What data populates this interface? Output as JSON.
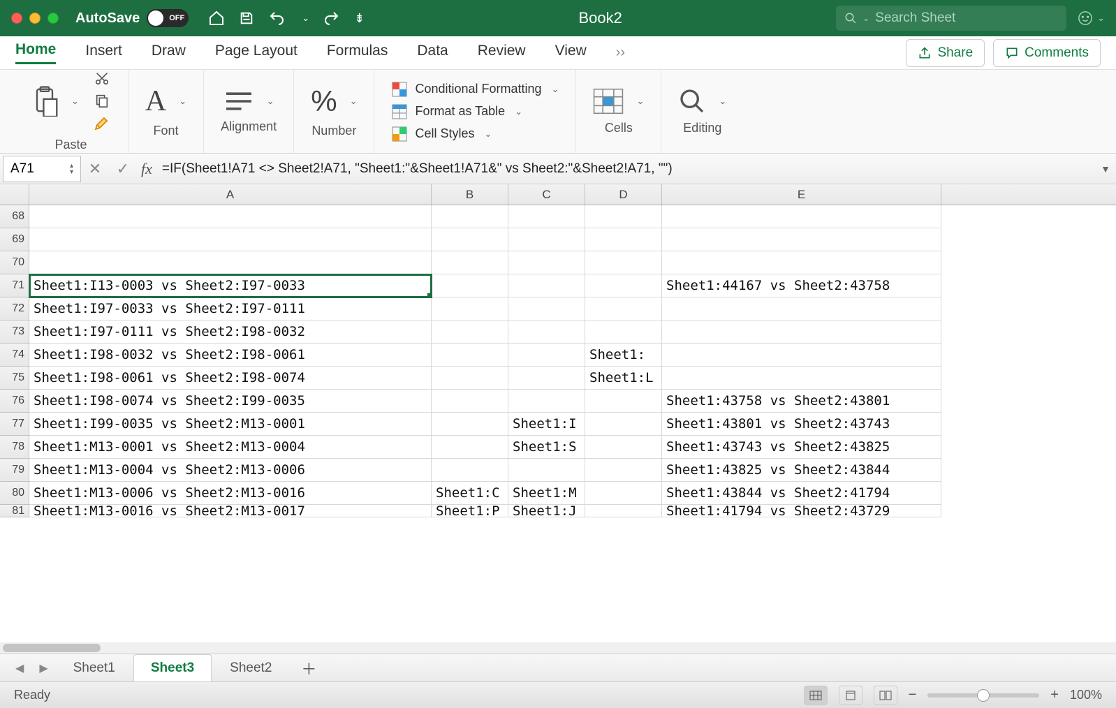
{
  "titlebar": {
    "autosave_label": "AutoSave",
    "autosave_state": "OFF",
    "doc_title": "Book2",
    "search_placeholder": "Search Sheet"
  },
  "tabs": {
    "home": "Home",
    "insert": "Insert",
    "draw": "Draw",
    "page_layout": "Page Layout",
    "formulas": "Formulas",
    "data": "Data",
    "review": "Review",
    "view": "View"
  },
  "ribbon_right": {
    "share": "Share",
    "comments": "Comments"
  },
  "ribbon_groups": {
    "paste": "Paste",
    "font": "Font",
    "alignment": "Alignment",
    "number": "Number",
    "cond_fmt": "Conditional Formatting",
    "fmt_table": "Format as Table",
    "cell_styles": "Cell Styles",
    "cells": "Cells",
    "editing": "Editing"
  },
  "formula_bar": {
    "namebox": "A71",
    "formula": "=IF(Sheet1!A71 <> Sheet2!A71, \"Sheet1:\"&Sheet1!A71&\" vs Sheet2:\"&Sheet2!A71, \"\")"
  },
  "columns": [
    "A",
    "B",
    "C",
    "D",
    "E"
  ],
  "rows": [
    {
      "n": 68,
      "A": "",
      "B": "",
      "C": "",
      "D": "",
      "E": ""
    },
    {
      "n": 69,
      "A": "",
      "B": "",
      "C": "",
      "D": "",
      "E": ""
    },
    {
      "n": 70,
      "A": "",
      "B": "",
      "C": "",
      "D": "",
      "E": ""
    },
    {
      "n": 71,
      "A": "Sheet1:I13-0003 vs Sheet2:I97-0033",
      "B": "",
      "C": "",
      "D": "",
      "E": "Sheet1:44167 vs Sheet2:43758",
      "sel": true
    },
    {
      "n": 72,
      "A": "Sheet1:I97-0033 vs Sheet2:I97-0111",
      "B": "",
      "C": "",
      "D": "",
      "E": ""
    },
    {
      "n": 73,
      "A": "Sheet1:I97-0111 vs Sheet2:I98-0032",
      "B": "",
      "C": "",
      "D": "",
      "E": ""
    },
    {
      "n": 74,
      "A": "Sheet1:I98-0032 vs Sheet2:I98-0061",
      "B": "",
      "C": "",
      "D": "Sheet1:",
      "E": ""
    },
    {
      "n": 75,
      "A": "Sheet1:I98-0061 vs Sheet2:I98-0074",
      "B": "",
      "C": "",
      "D": "Sheet1:L",
      "E": ""
    },
    {
      "n": 76,
      "A": "Sheet1:I98-0074 vs Sheet2:I99-0035",
      "B": "",
      "C": "",
      "D": "",
      "E": "Sheet1:43758 vs Sheet2:43801"
    },
    {
      "n": 77,
      "A": "Sheet1:I99-0035 vs Sheet2:M13-0001",
      "B": "",
      "C": "Sheet1:I",
      "D": "",
      "E": "Sheet1:43801 vs Sheet2:43743"
    },
    {
      "n": 78,
      "A": "Sheet1:M13-0001 vs Sheet2:M13-0004",
      "B": "",
      "C": "Sheet1:S",
      "D": "",
      "E": "Sheet1:43743 vs Sheet2:43825"
    },
    {
      "n": 79,
      "A": "Sheet1:M13-0004 vs Sheet2:M13-0006",
      "B": "",
      "C": "",
      "D": "",
      "E": "Sheet1:43825 vs Sheet2:43844"
    },
    {
      "n": 80,
      "A": "Sheet1:M13-0006 vs Sheet2:M13-0016",
      "B": "Sheet1:C",
      "C": "Sheet1:M",
      "D": "",
      "E": "Sheet1:43844 vs Sheet2:41794"
    },
    {
      "n": 81,
      "A": "Sheet1:M13-0016 vs Sheet2:M13-0017",
      "B": "Sheet1:P",
      "C": "Sheet1:J",
      "D": "",
      "E": "Sheet1:41794 vs Sheet2:43729",
      "cut": true
    }
  ],
  "sheet_tabs": {
    "sheet1": "Sheet1",
    "sheet3": "Sheet3",
    "sheet2": "Sheet2"
  },
  "statusbar": {
    "ready": "Ready",
    "zoom": "100%"
  }
}
